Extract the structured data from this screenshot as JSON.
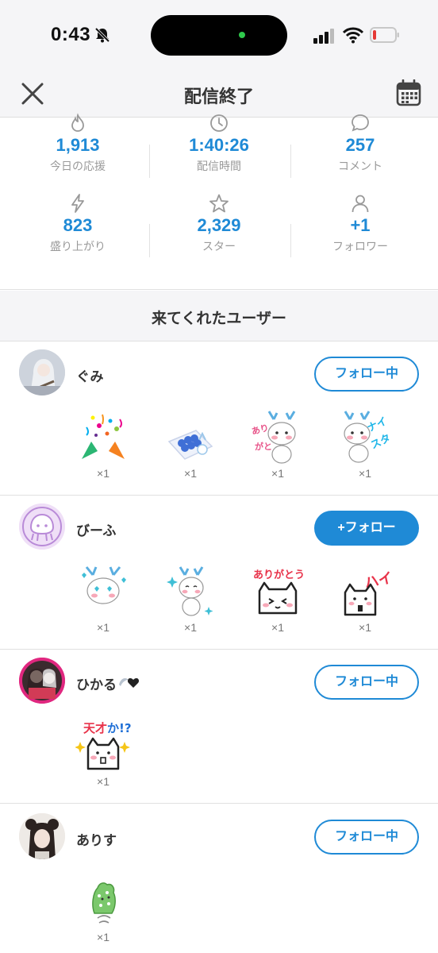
{
  "status_bar": {
    "time": "0:43"
  },
  "header": {
    "title": "配信終了"
  },
  "stats": [
    {
      "icon": "flame-icon",
      "value": "1,913",
      "label": "今日の応援"
    },
    {
      "icon": "clock-icon",
      "value": "1:40:26",
      "label": "配信時間"
    },
    {
      "icon": "comment-icon",
      "value": "257",
      "label": "コメント"
    },
    {
      "icon": "lightning-icon",
      "value": "823",
      "label": "盛り上がり"
    },
    {
      "icon": "star-icon",
      "value": "2,329",
      "label": "スター"
    },
    {
      "icon": "person-icon",
      "value": "+1",
      "label": "フォロワー"
    }
  ],
  "section": {
    "title": "来てくれたユーザー"
  },
  "users": [
    {
      "name": "ぐみ",
      "button": "フォロー中",
      "gifts": [
        {
          "sticker": "confetti-sticker",
          "count": "×1"
        },
        {
          "sticker": "flower-box-sticker",
          "count": "×1"
        },
        {
          "sticker": "dragon-thanks-sticker",
          "count": "×1",
          "text": "ありがとう"
        },
        {
          "sticker": "dragon-nice-sticker",
          "count": "×1",
          "text": "ナイスタ!"
        }
      ]
    },
    {
      "name": "びーふ",
      "button": "+フォロー",
      "gifts": [
        {
          "sticker": "dragon-hearts-sticker",
          "count": "×1"
        },
        {
          "sticker": "dragon-sparkle-sticker",
          "count": "×1"
        },
        {
          "sticker": "cat-thanks-sticker",
          "count": "×1",
          "text": "ありがとう!"
        },
        {
          "sticker": "cat-hai-sticker",
          "count": "×1",
          "text": "ハイ!"
        }
      ]
    },
    {
      "name": "ひかる",
      "button": "フォロー中",
      "gifts": [
        {
          "sticker": "cat-genius-sticker",
          "count": "×1",
          "text": "天才か!?"
        }
      ]
    },
    {
      "name": "ありす",
      "button": "フォロー中",
      "gifts": [
        {
          "sticker": "cactus-sticker",
          "count": "×1"
        }
      ]
    }
  ],
  "colors": {
    "accent": "#1f8ad6",
    "background": "#f5f5f7"
  }
}
